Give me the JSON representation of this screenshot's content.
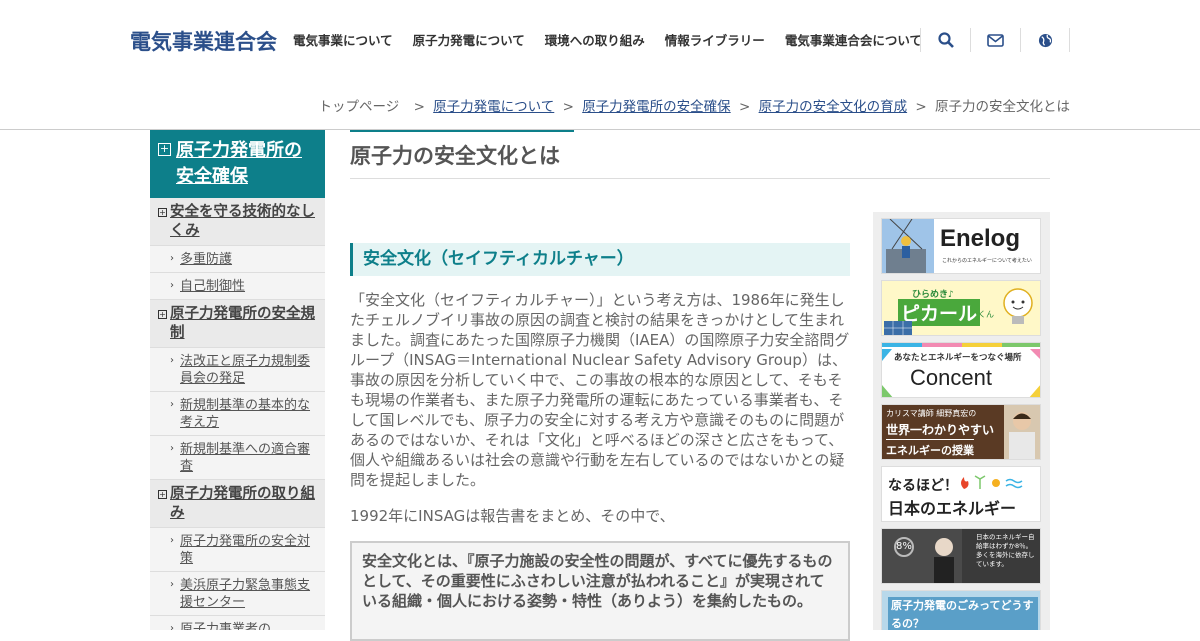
{
  "header": {
    "logo": "電気事業連合会",
    "nav": [
      "電気事業について",
      "原子力発電について",
      "環境への取り組み",
      "情報ライブラリー",
      "電気事業連合会について"
    ]
  },
  "breadcrumb": {
    "home": "トップページ",
    "link1": "原子力発電について",
    "link2": "原子力発電所の安全確保",
    "link3": "原子力の安全文化の育成",
    "current": "原子力の安全文化とは",
    "sep": ">"
  },
  "sidebar": {
    "head": "原子力発電所の安全確保",
    "cat1": "安全を守る技術的なしくみ",
    "cat1_items": [
      "多重防護",
      "自己制御性"
    ],
    "cat2": "原子力発電所の安全規制",
    "cat2_items": [
      "法改正と原子力規制委員会の発足",
      "新規制基準の基本的な考え方",
      "新規制基準への適合審査"
    ],
    "cat3": "原子力発電所の取り組み",
    "cat3_items": [
      "原子力発電所の安全対策",
      "美浜原子力緊急事態支援センター",
      "原子力事業者の..."
    ]
  },
  "main": {
    "title": "原子力の安全文化とは",
    "h2": "安全文化（セイフティカルチャー）",
    "para1": "「安全文化（セイフティカルチャー）」という考え方は、1986年に発生したチェルノブイリ事故の原因の調査と検討の結果をきっかけとして生まれました。調査にあたった国際原子力機関（IAEA）の国際原子力安全諮問グループ（INSAG＝International Nuclear Safety Advisory Group）は、事故の原因を分析していく中で、この事故の根本的な原因として、そもそも現場の作業者も、また原子力発電所の運転にあたっている事業者も、そして国レベルでも、原子力の安全に対する考え方や意識そのものに問題があるのではないか、それは「文化」と呼べるほどの深さと広さをもって、個人や組織あるいは社会の意識や行動を左右しているのではないかとの疑問を提起しました。",
    "para2": "1992年にINSAGは報告書をまとめ、その中で、",
    "quote": "安全文化とは、『原子力施設の安全性の問題が、すべてに優先するものとして、その重要性にふさわしい注意が払われること』が実現されている組織・個人における姿勢・特性（ありよう）を集約したもの。"
  },
  "banners": {
    "enelog": "Enelog",
    "enelog_sub": "これからのエネルギーについて考えたい",
    "pical_top": "ひらめき♪",
    "pical": "ピカール",
    "pical_suffix": "くん",
    "concent_top": "あなたとエネルギーをつなぐ場所",
    "concent": "Concent",
    "lecture_top": "カリスマ講師 細野真宏の",
    "lecture_mid": "世界一わかりやすい",
    "lecture_bottom": "エネルギーの授業",
    "naruhodo_top": "なるほど！",
    "naruhodo_bottom": "日本のエネルギー",
    "selfsuff": "日本のエネルギー自給率はわずか8％。多くを海外に依存しています。",
    "selfsuff_num": "8%",
    "gomi": "原子力発電のごみってどうするの？"
  },
  "colors": {
    "brand": "#2b4f8a",
    "accent": "#0d7f8a"
  }
}
